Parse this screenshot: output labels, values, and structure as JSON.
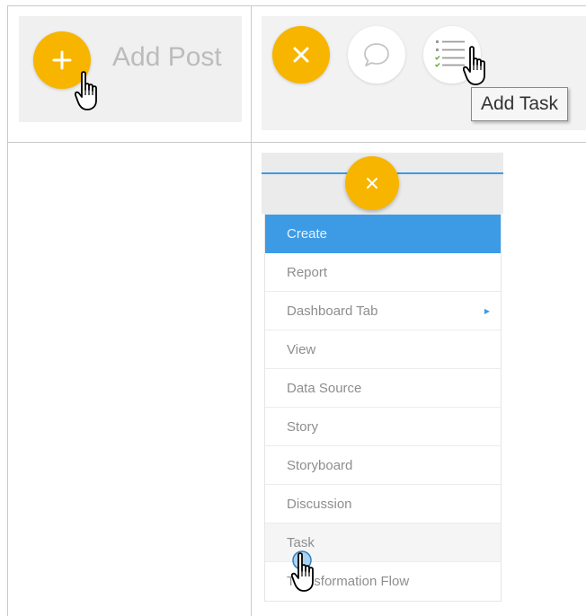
{
  "cell_add_post": {
    "label": "Add Post",
    "icon": "plus-icon",
    "cursor": "hand-pointer-icon"
  },
  "cell_actions": {
    "close_icon": "close-icon",
    "discussion_icon": "speech-bubble-icon",
    "task_icon": "task-list-icon",
    "tooltip": "Add Task",
    "cursor": "hand-pointer-icon"
  },
  "create_menu": {
    "close_icon": "close-icon",
    "items": [
      {
        "label": "Create",
        "state": "active"
      },
      {
        "label": "Report"
      },
      {
        "label": "Dashboard Tab",
        "submenu": true
      },
      {
        "label": "View"
      },
      {
        "label": "Data Source"
      },
      {
        "label": "Story"
      },
      {
        "label": "Storyboard"
      },
      {
        "label": "Discussion"
      },
      {
        "label": "Task",
        "state": "hover"
      },
      {
        "label": "Transformation Flow"
      }
    ],
    "cursor": "hand-pointer-click-icon"
  },
  "colors": {
    "accent_orange": "#f7b500",
    "menu_blue": "#3d9be5",
    "panel_gray": "#f0f0f0"
  }
}
